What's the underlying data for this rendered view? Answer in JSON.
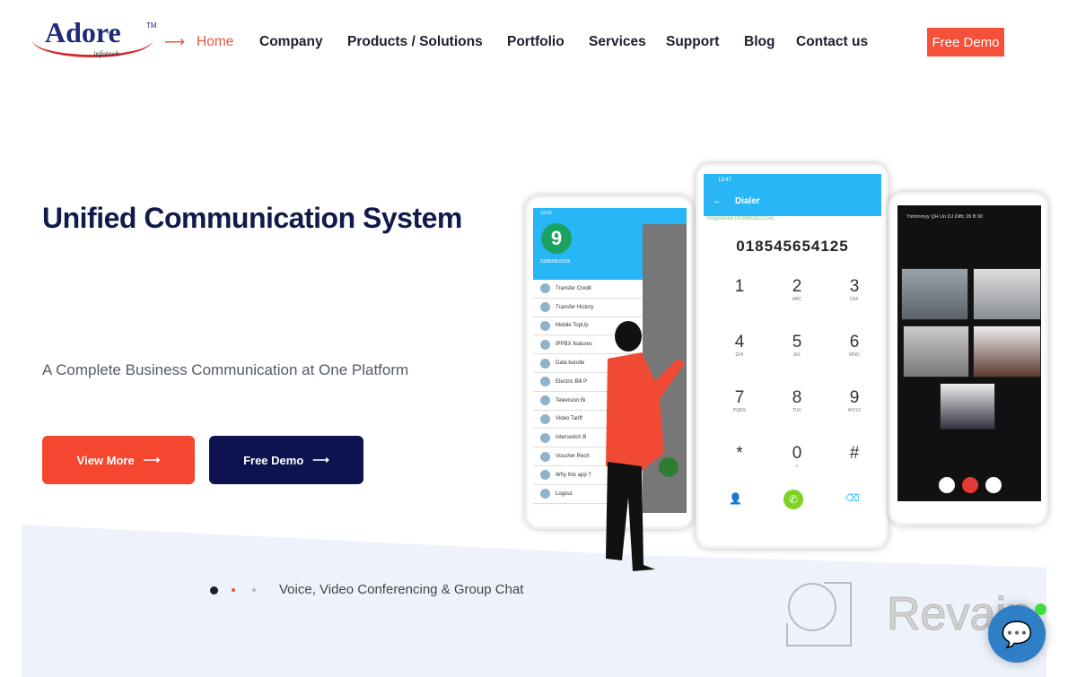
{
  "brand": {
    "logo_text": "Adore",
    "tm": "TM",
    "tagline": "infotech"
  },
  "nav": {
    "items": [
      "Home",
      "Company",
      "Products / Solutions",
      "Portfolio",
      "Services",
      "Support",
      "Blog",
      "Contact us"
    ],
    "active": "Home",
    "cta": "Free Demo"
  },
  "hero": {
    "title": "Unified Communication System",
    "subtitle": "A Complete Business Communication at One Platform",
    "buttons": {
      "view_more": "View More",
      "free_demo": "Free Demo"
    }
  },
  "slider": {
    "caption": "Voice, Video Conferencing & Group Chat",
    "dots": 3,
    "active_dot": 0
  },
  "phone_menu": {
    "time": "19:03",
    "badge": "9",
    "number": "918800810156",
    "items": [
      "Transfer Credit",
      "Transfer History",
      "Mobile TopUp",
      "IPPBX features",
      "Data bundle",
      "Electric Bill P",
      "Television Bi",
      "Video Tariff",
      "Interswitch B",
      "Voucher Rech",
      "Why this app ?",
      "Logout"
    ]
  },
  "phone_dialer": {
    "time": "13:47",
    "title": "Dialer",
    "status": "Registered (918800810156)",
    "number": "018545654125",
    "keys": [
      [
        "1",
        ""
      ],
      [
        "2",
        "ABC"
      ],
      [
        "3",
        "DEF"
      ],
      [
        "4",
        "GHI"
      ],
      [
        "5",
        "JKL"
      ],
      [
        "6",
        "MNO"
      ],
      [
        "7",
        "PQRS"
      ],
      [
        "8",
        "TUV"
      ],
      [
        "9",
        "WXYZ"
      ],
      [
        "*",
        ""
      ],
      [
        "0",
        "+"
      ],
      [
        "#",
        ""
      ]
    ]
  },
  "phone_video": {
    "header": "Yshtmmyy QH Un DJ Diffc 26 B 90"
  },
  "watermark": "Revain",
  "colors": {
    "accent": "#f4503a",
    "navy": "#0c1350",
    "sky": "#29b6f6",
    "call": "#7ed321"
  }
}
